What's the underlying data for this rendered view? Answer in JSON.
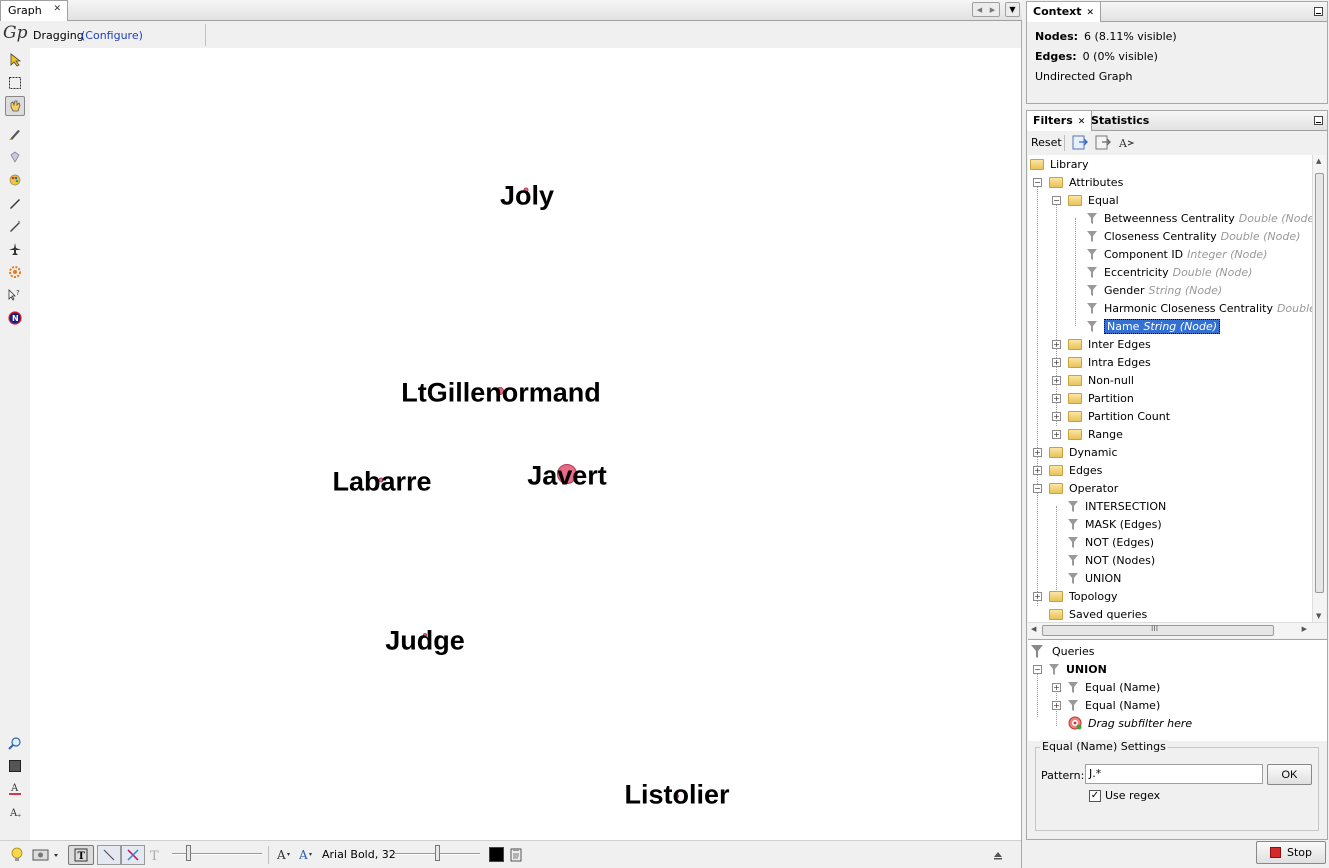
{
  "graph": {
    "tab_title": "Graph",
    "mode": "Dragging",
    "configure_link": "(Configure)",
    "nodes": [
      {
        "label": "Joly"
      },
      {
        "label": "LtGillenormand"
      },
      {
        "label": "Labarre"
      },
      {
        "label": "Javert"
      },
      {
        "label": "Judge"
      },
      {
        "label": "Listolier"
      }
    ],
    "node_color": "#e86a86",
    "font_label": "Arial Bold, 32"
  },
  "context": {
    "tab_title": "Context",
    "nodes_label": "Nodes:",
    "nodes_value": "6 (8.11% visible)",
    "edges_label": "Edges:",
    "edges_value": "0 (0% visible)",
    "graph_type": "Undirected Graph"
  },
  "filters": {
    "tab_filters": "Filters",
    "tab_statistics": "Statistics",
    "reset_label": "Reset",
    "scrollbar_grip": "III",
    "tree": {
      "library": "Library",
      "attributes": "Attributes",
      "equal": "Equal",
      "equal_items": [
        {
          "name": "Betweenness Centrality",
          "type": "Double (Node)"
        },
        {
          "name": "Closeness Centrality",
          "type": "Double (Node)"
        },
        {
          "name": "Component ID",
          "type": "Integer (Node)"
        },
        {
          "name": "Eccentricity",
          "type": "Double (Node)"
        },
        {
          "name": "Gender",
          "type": "String (Node)"
        },
        {
          "name": "Harmonic Closeness Centrality",
          "type": "Double (No"
        },
        {
          "name": "Name",
          "type": "String (Node)"
        }
      ],
      "attr_folders": [
        "Inter Edges",
        "Intra Edges",
        "Non-null",
        "Partition",
        "Partition Count",
        "Range"
      ],
      "dynamic": "Dynamic",
      "edges": "Edges",
      "operator": "Operator",
      "operator_items": [
        "INTERSECTION",
        "MASK (Edges)",
        "NOT (Edges)",
        "NOT (Nodes)",
        "UNION"
      ],
      "topology": "Topology",
      "saved_queries": "Saved queries"
    },
    "queries": {
      "title": "Queries",
      "root": "UNION",
      "children": [
        "Equal (Name)",
        "Equal (Name)"
      ],
      "drag_hint": "Drag subfilter here"
    },
    "settings": {
      "title": "Equal (Name) Settings",
      "pattern_label": "Pattern:",
      "pattern_value": "J.*",
      "ok_label": "OK",
      "use_regex_label": "Use regex",
      "use_regex_checked": true
    },
    "stop_label": "Stop"
  }
}
